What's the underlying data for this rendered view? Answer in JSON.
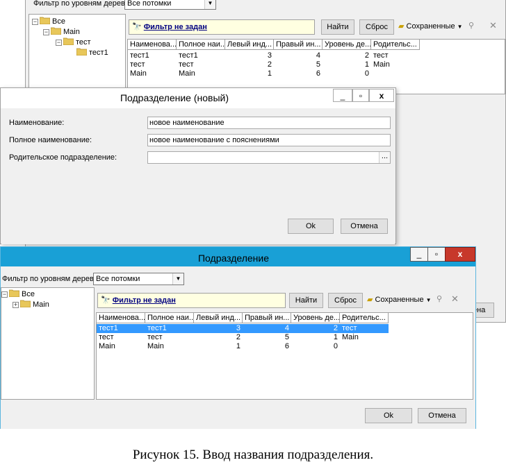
{
  "back_window": {
    "filter_label": "Фильтр по уровням дерева:",
    "filter_value": "Все потомки",
    "tree": [
      "Все",
      "Main",
      "тест",
      "тест1"
    ],
    "filter_link": "Фильтр не задан",
    "find_button": "Найти",
    "reset_button": "Сброс",
    "saved_label": "Сохраненные",
    "columns": [
      "Наименова...",
      "Полное наи...",
      "Левый инд...",
      "Правый ин...",
      "Уровень де...",
      "Родительс..."
    ],
    "rows": [
      [
        "тест1",
        "тест1",
        "3",
        "4",
        "2",
        "тест"
      ],
      [
        "тест",
        "тест",
        "2",
        "5",
        "1",
        "Main"
      ],
      [
        "Main",
        "Main",
        "1",
        "6",
        "0",
        ""
      ]
    ],
    "hidden_button_fragment": "ена"
  },
  "dialog": {
    "title": "Подразделение (новый)",
    "name_label": "Наименование:",
    "name_value": "новое наименование",
    "fullname_label": "Полное наименование:",
    "fullname_value": "новое наименование с пояснениями",
    "parent_label": "Родительское подразделение:",
    "parent_value": "",
    "browse_label": "...",
    "ok_button": "Ok",
    "cancel_button": "Отмена"
  },
  "front_window": {
    "title": "Подразделение",
    "filter_label": "Фильтр по уровням дерева:",
    "filter_value": "Все потомки",
    "tree": [
      "Все",
      "Main"
    ],
    "filter_link": "Фильтр не задан",
    "find_button": "Найти",
    "reset_button": "Сброс",
    "saved_label": "Сохраненные",
    "columns": [
      "Наименова...",
      "Полное наи...",
      "Левый инд...",
      "Правый ин...",
      "Уровень де...",
      "Родительс..."
    ],
    "rows": [
      [
        "тест1",
        "тест1",
        "3",
        "4",
        "2",
        "тест"
      ],
      [
        "тест",
        "тест",
        "2",
        "5",
        "1",
        "Main"
      ],
      [
        "Main",
        "Main",
        "1",
        "6",
        "0",
        ""
      ]
    ],
    "selected_row": 0,
    "ok_button": "Ok",
    "cancel_button": "Отмена"
  },
  "caption": "Рисунок 15. Ввод названия подразделения.",
  "colors": {
    "titlebar_active": "#19a0d6",
    "titlebar_inactive": "#f0f0f0",
    "close_red": "#c7382b",
    "selection": "#3399ff",
    "filter_bg": "#ffffe1",
    "folder": "#e8c75a"
  },
  "icons": [
    "folder-icon",
    "binoculars-icon",
    "saved-filters-icon",
    "pin-icon",
    "close-icon",
    "minimize-icon",
    "maximize-icon",
    "dropdown-arrow-icon"
  ]
}
